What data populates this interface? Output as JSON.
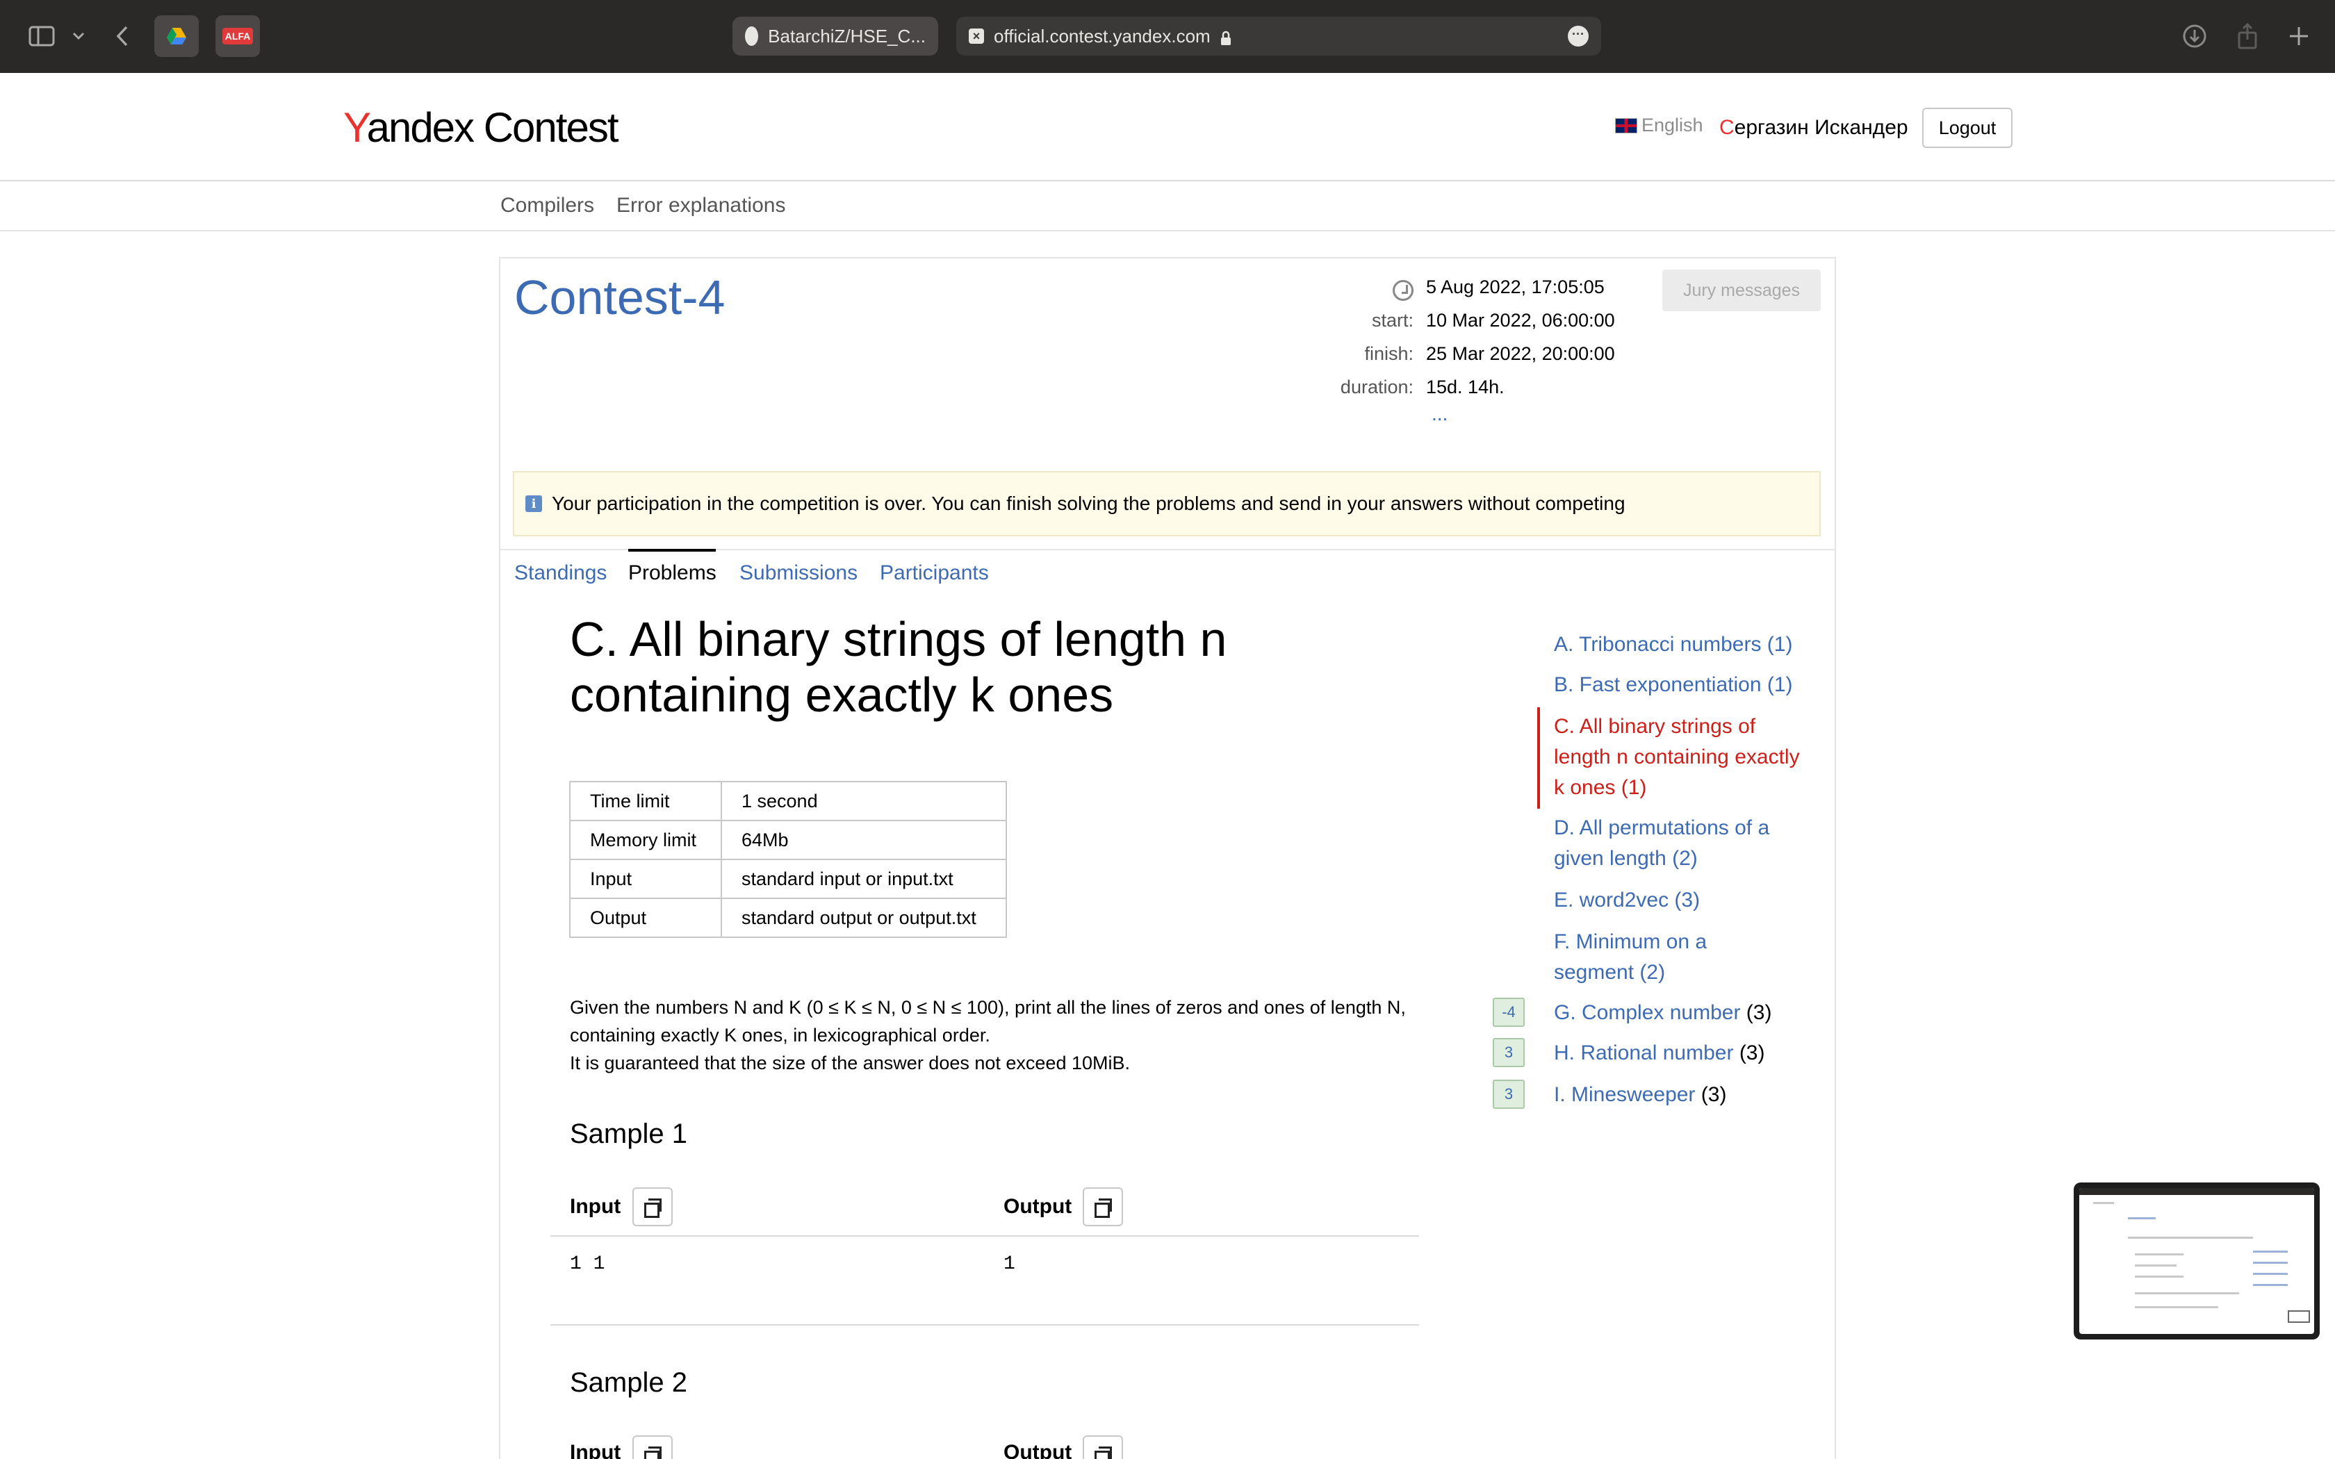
{
  "browser": {
    "tabs": [
      {
        "label": "BatarchiZ/HSE_C..."
      },
      {
        "label": "official.contest.yandex.com"
      }
    ],
    "ext_alfa": "ALFA"
  },
  "header": {
    "logo_y": "Y",
    "logo_rest": "andex Contest",
    "language": "English",
    "user_first": "С",
    "user_rest": "ергазин Искандер",
    "logout": "Logout"
  },
  "subnav": {
    "compilers": "Compilers",
    "errors": "Error explanations"
  },
  "contest": {
    "title": "Contest-4",
    "now": "5 Aug 2022, 17:05:05",
    "start_label": "start:",
    "start": "10 Mar 2022, 06:00:00",
    "finish_label": "finish:",
    "finish": "25 Mar 2022, 20:00:00",
    "duration_label": "duration:",
    "duration": "15d. 14h.",
    "more": "...",
    "jury_messages": "Jury messages",
    "notice": "Your participation in the competition is over. You can finish solving the problems and send in your answers without competing"
  },
  "tabs": {
    "standings": "Standings",
    "problems": "Problems",
    "submissions": "Submissions",
    "participants": "Participants"
  },
  "problem": {
    "title_line1": "C. All binary strings of length n",
    "title_line2": "containing exactly k ones",
    "limits": [
      {
        "key": "Time limit",
        "value": "1 second"
      },
      {
        "key": "Memory limit",
        "value": "64Mb"
      },
      {
        "key": "Input",
        "value": "standard input or input.txt"
      },
      {
        "key": "Output",
        "value": "standard output or output.txt"
      }
    ],
    "statement_line1": "Given the numbers N and K (0 ≤ K ≤ N, 0 ≤ N ≤ 100), print all the lines of zeros and ones of length N,",
    "statement_line2": "containing exactly K ones, in lexicographical order.",
    "statement_line3": "It is guaranteed that the size of the answer does not exceed 10MiB.",
    "sample1_title": "Sample 1",
    "sample2_title": "Sample 2",
    "input_label": "Input",
    "output_label": "Output",
    "sample1_input": "1  1",
    "sample1_output": "1"
  },
  "problem_list": [
    {
      "label": "A. Tribonacci numbers (1)"
    },
    {
      "label": "B. Fast exponentiation (1)"
    },
    {
      "label_line1": "C. All binary strings of",
      "label_line2": "length n containing exactly",
      "label_line3": "k ones (1)"
    },
    {
      "label_line1": "D. All permutations of a",
      "label_line2": "given length (2)"
    },
    {
      "label": "E. word2vec (3)"
    },
    {
      "label_line1": "F. Minimum on a",
      "label_line2": "segment (2)"
    },
    {
      "label": "G. Complex number",
      "count": "(3)",
      "score": "-4"
    },
    {
      "label": "H. Rational number",
      "count": "(3)",
      "score": "3"
    },
    {
      "label": "I. Minesweeper",
      "count": "(3)",
      "score": "3"
    }
  ]
}
